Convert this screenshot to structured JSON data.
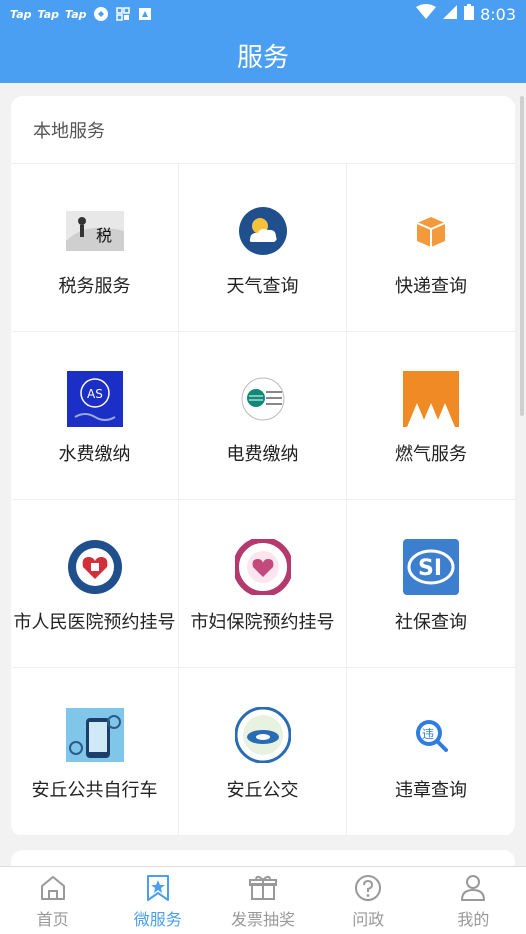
{
  "status_bar": {
    "apps": [
      "Tap",
      "Tap",
      "Tap"
    ],
    "time": "8:03"
  },
  "header": {
    "title": "服务"
  },
  "local_services": {
    "title": "本地服务",
    "items": [
      {
        "label": "税务服务",
        "icon": "tax-icon"
      },
      {
        "label": "天气查询",
        "icon": "weather-icon"
      },
      {
        "label": "快递查询",
        "icon": "package-icon"
      },
      {
        "label": "水费缴纳",
        "icon": "water-bill-icon"
      },
      {
        "label": "电费缴纳",
        "icon": "electricity-icon"
      },
      {
        "label": "燃气服务",
        "icon": "gas-icon"
      },
      {
        "label": "市人民医院预约挂号",
        "icon": "city-hospital-icon"
      },
      {
        "label": "市妇保院预约挂号",
        "icon": "maternal-hospital-icon"
      },
      {
        "label": "社保查询",
        "icon": "social-security-icon"
      },
      {
        "label": "安丘公共自行车",
        "icon": "bicycle-icon"
      },
      {
        "label": "安丘公交",
        "icon": "bus-icon"
      },
      {
        "label": "违章查询",
        "icon": "violation-icon"
      }
    ]
  },
  "tabbar": {
    "tabs": [
      {
        "label": "首页",
        "icon": "home-icon"
      },
      {
        "label": "微服务",
        "icon": "bookmark-star-icon"
      },
      {
        "label": "发票抽奖",
        "icon": "gift-icon"
      },
      {
        "label": "问政",
        "icon": "question-icon"
      },
      {
        "label": "我的",
        "icon": "user-icon"
      }
    ],
    "active_index": 1
  },
  "colors": {
    "accent": "#4a9ff2",
    "inactive": "#999999"
  }
}
